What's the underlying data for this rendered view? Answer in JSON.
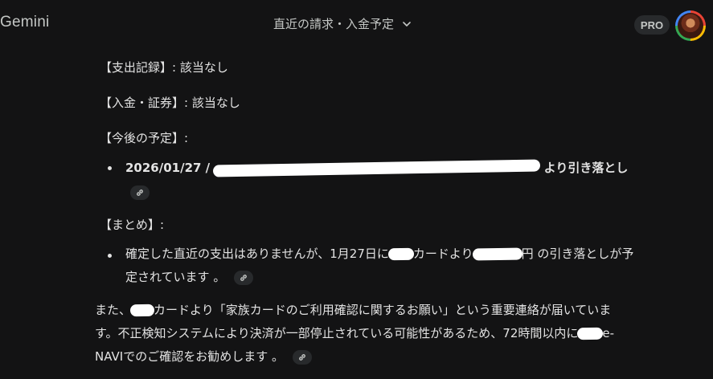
{
  "header": {
    "brand": "Gemini",
    "chat_title": "直近の請求・入金予定",
    "pro_badge": "PRO"
  },
  "message": {
    "expense_record": "【支出記録】: 該当なし",
    "deposit_securities": "【入金・証券】: 該当なし",
    "future_plan_heading": "【今後の予定】:",
    "future_item_date": "2026/01/27 /",
    "future_item_suffix": "より引き落とし",
    "summary_heading": "【まとめ】:",
    "summary_line1_a": "確定した直近の支出はありませんが、1月27日に",
    "summary_line1_b": "カードより",
    "summary_line1_c": "円 の引き落としが予",
    "summary_line2": "定されています 。",
    "para_line1_a": "また、",
    "para_line1_b": "カードより「家族カードのご利用確認に関するお願い」という重要連絡が届いていま",
    "para_line2_a": "す。不正検知システムにより決済が一部停止されている可能性があるため、72時間以内に",
    "para_line2_b": "e-",
    "para_line3": "NAVIでのご確認をお勧めします 。"
  }
}
